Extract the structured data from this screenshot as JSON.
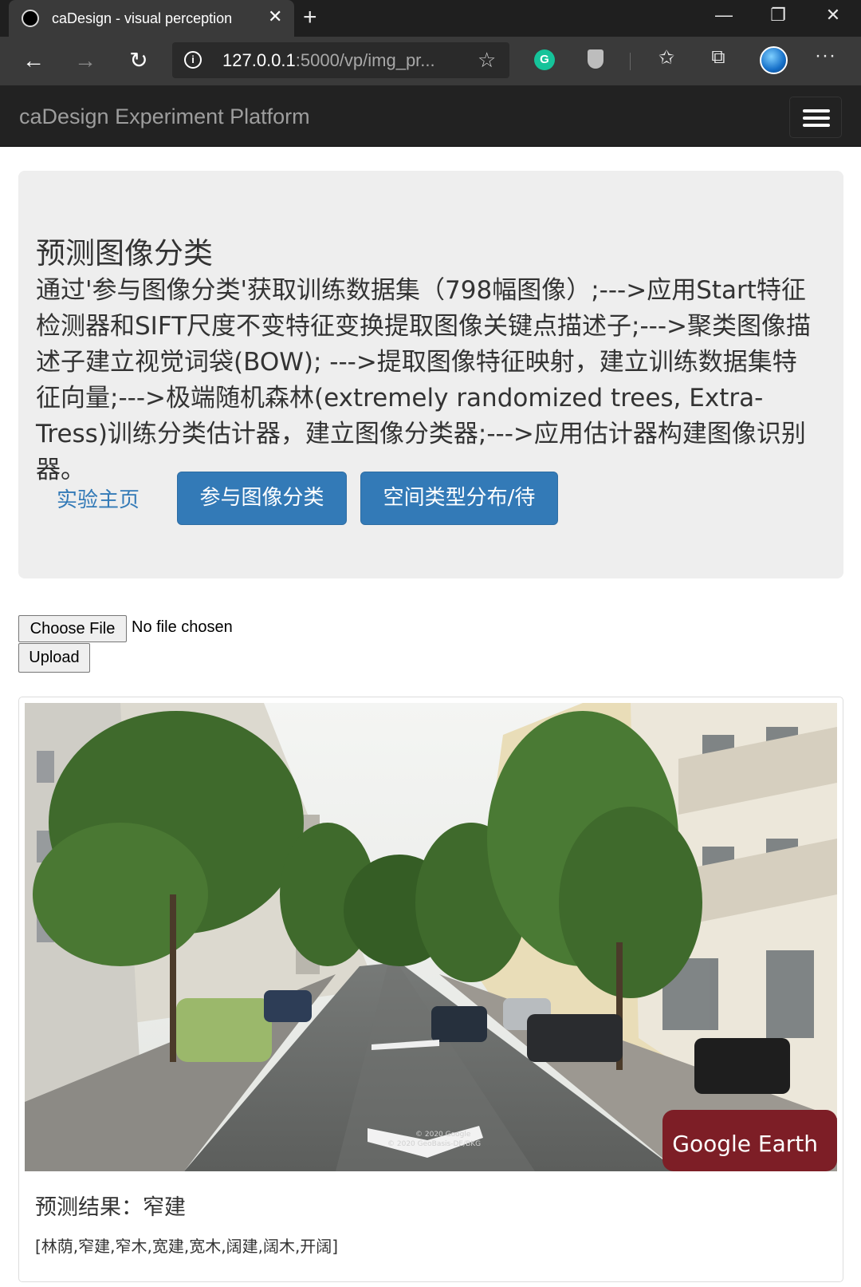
{
  "browser": {
    "tab_title": "caDesign - visual perception",
    "url_host": "127.0.0.1",
    "url_rest": ":5000/vp/img_pr...",
    "window_controls": [
      "minimize-icon",
      "restore-icon",
      "close-icon"
    ]
  },
  "navbar": {
    "brand": "caDesign Experiment Platform"
  },
  "jumbotron": {
    "title": "预测图像分类",
    "description": "通过'参与图像分类'获取训练数据集（798幅图像）;--->应用Start特征检测器和SIFT尺度不变特征变换提取图像关键点描述子;--->聚类图像描述子建立视觉词袋(BOW); --->提取图像特征映射，建立训练数据集特征向量;--->极端随机森林(extremely randomized trees, Extra-Tress)训练分类估计器，建立图像分类器;--->应用估计器构建图像识别器。",
    "link_home": "实验主页",
    "btn_classify": "参与图像分类",
    "btn_distribution": "空间类型分布/待"
  },
  "upload": {
    "choose_label": "Choose File",
    "no_file": "No file chosen",
    "upload_label": "Upload"
  },
  "result": {
    "watermark": "Google Earth",
    "copyright_1": "© 2020 Google",
    "copyright_2": "© 2020 GeoBasis-DE/BKG",
    "prediction": "预测结果：窄建",
    "classes": "[林荫,窄建,窄木,宽建,宽木,阔建,阔木,开阔]"
  }
}
